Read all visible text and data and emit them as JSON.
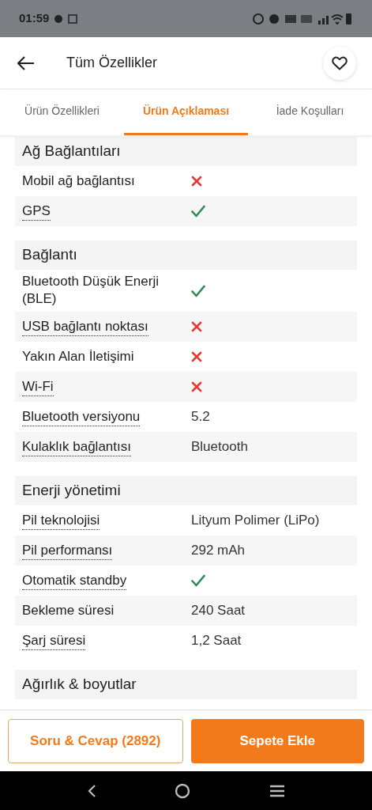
{
  "status_bar": {
    "time": "01:59"
  },
  "header": {
    "title": "Tüm Özellikler"
  },
  "tabs": [
    {
      "label": "Ürün Özellikleri",
      "selected": false
    },
    {
      "label": "Ürün Açıklaması",
      "selected": true
    },
    {
      "label": "İade Koşulları",
      "selected": false
    }
  ],
  "sections": [
    {
      "title": "Ağ Bağlantıları",
      "rows": [
        {
          "label": "Mobil ağ bağlantısı",
          "dotted": false,
          "kind": "no"
        },
        {
          "label": "GPS",
          "dotted": true,
          "kind": "yes"
        }
      ]
    },
    {
      "title": "Bağlantı",
      "rows": [
        {
          "label": "Bluetooth Düşük Enerji (BLE)",
          "dotted": false,
          "kind": "yes"
        },
        {
          "label": "USB bağlantı noktası",
          "dotted": true,
          "kind": "no"
        },
        {
          "label": "Yakın Alan İletişimi",
          "dotted": false,
          "kind": "no"
        },
        {
          "label": "Wi-Fi",
          "dotted": true,
          "kind": "no"
        },
        {
          "label": "Bluetooth versiyonu",
          "dotted": true,
          "kind": "text",
          "value": "5.2"
        },
        {
          "label": "Kulaklık bağlantısı",
          "dotted": true,
          "kind": "text",
          "value": "Bluetooth"
        }
      ]
    },
    {
      "title": "Enerji yönetimi",
      "rows": [
        {
          "label": "Pil teknolojisi",
          "dotted": true,
          "kind": "text",
          "value": "Lityum Polimer (LiPo)"
        },
        {
          "label": "Pil performansı",
          "dotted": true,
          "kind": "text",
          "value": "292 mAh"
        },
        {
          "label": "Otomatik standby",
          "dotted": true,
          "kind": "yes"
        },
        {
          "label": "Bekleme süresi",
          "dotted": false,
          "kind": "text",
          "value": "240 Saat"
        },
        {
          "label": "Şarj süresi",
          "dotted": true,
          "kind": "text",
          "value": "1,2 Saat"
        }
      ]
    },
    {
      "title": "Ağırlık & boyutlar"
    }
  ],
  "bottom_buttons": [
    {
      "label": "Soru & Cevap (2892)",
      "kind": "outline"
    },
    {
      "label": "Sepete Ekle",
      "kind": "filled"
    }
  ]
}
